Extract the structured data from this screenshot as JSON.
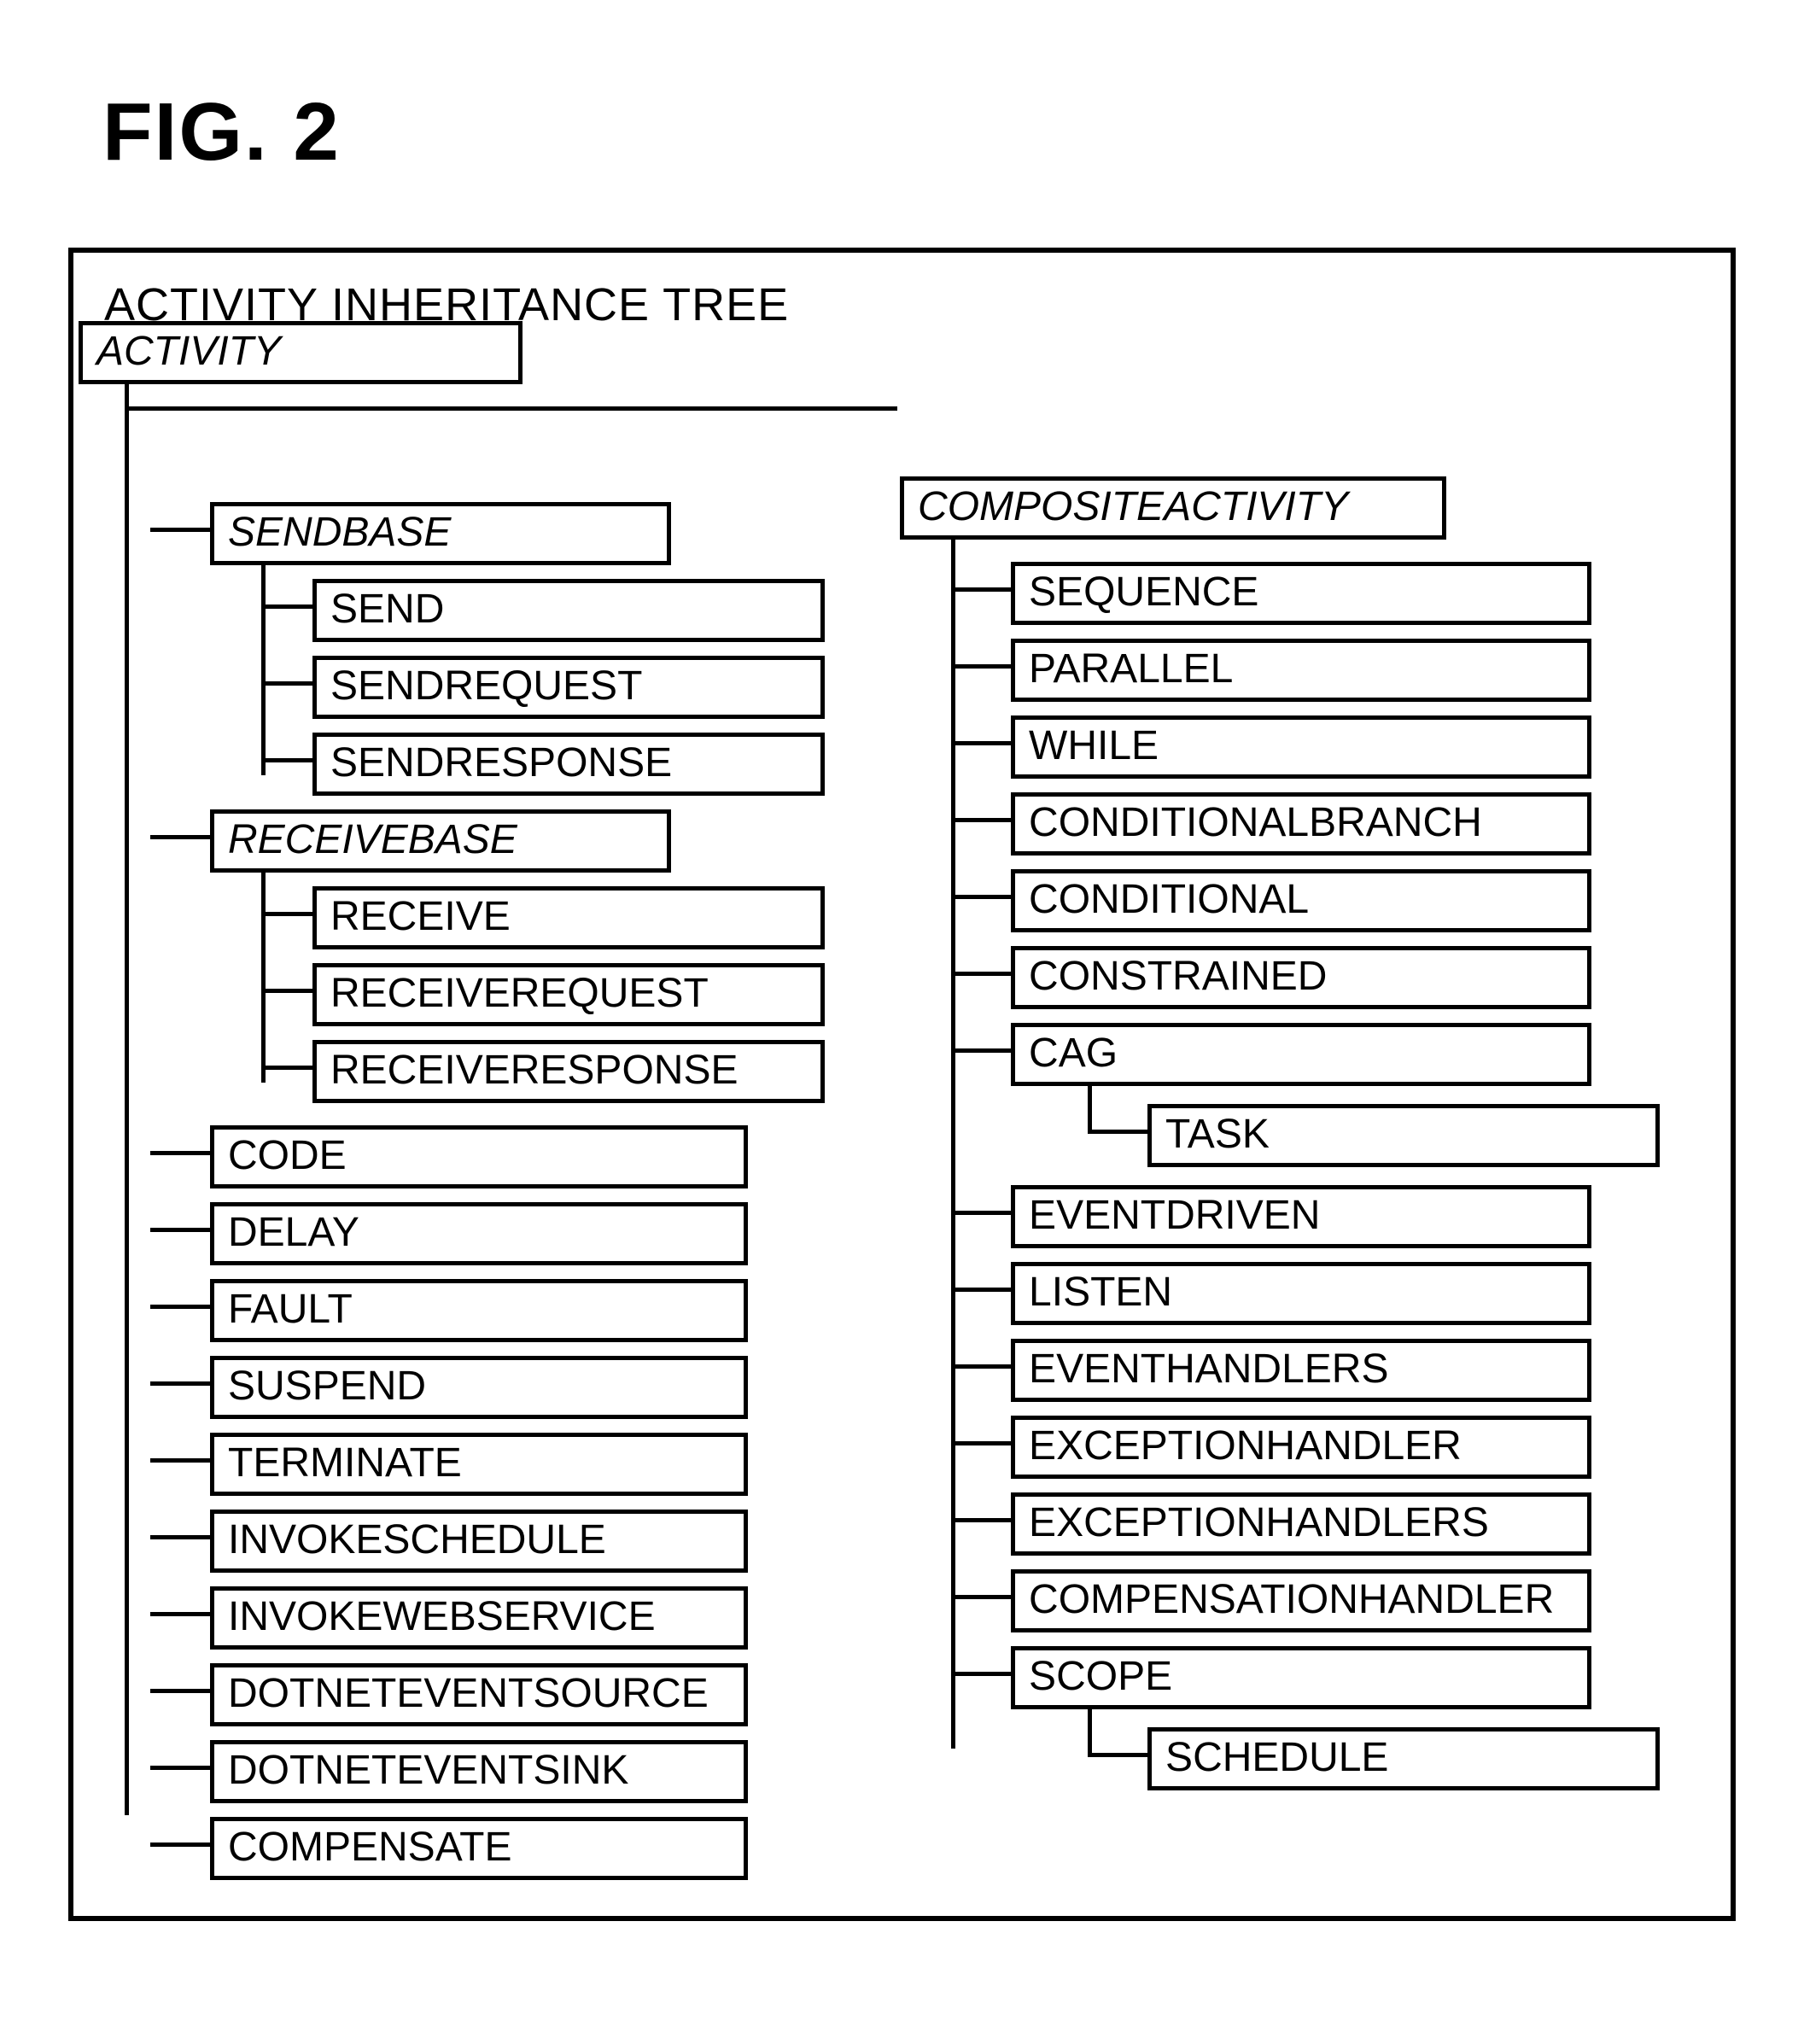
{
  "figure_label": "FIG. 2",
  "panel_title": "ACTIVITY INHERITANCE TREE",
  "root": "ACTIVITY",
  "left": {
    "sendbase": {
      "label": "SENDBASE",
      "children": [
        "SEND",
        "SENDREQUEST",
        "SENDRESPONSE"
      ]
    },
    "receivebase": {
      "label": "RECEIVEBASE",
      "children": [
        "RECEIVE",
        "RECEIVEREQUEST",
        "RECEIVERESPONSE"
      ]
    },
    "simple": [
      "CODE",
      "DELAY",
      "FAULT",
      "SUSPEND",
      "TERMINATE",
      "INVOKESCHEDULE",
      "INVOKEWEBSERVICE",
      "DOTNETEVENTSOURCE",
      "DOTNETEVENTSINK",
      "COMPENSATE"
    ]
  },
  "right": {
    "composite": {
      "label": "COMPOSITEACTIVITY",
      "children_first": [
        "SEQUENCE",
        "PARALLEL",
        "WHILE",
        "CONDITIONALBRANCH",
        "CONDITIONAL",
        "CONSTRAINED"
      ],
      "cag": {
        "label": "CAG",
        "child": "TASK"
      },
      "children_mid": [
        "EVENTDRIVEN",
        "LISTEN",
        "EVENTHANDLERS",
        "EXCEPTIONHANDLER",
        "EXCEPTIONHANDLERS",
        "COMPENSATIONHANDLER"
      ],
      "scope": {
        "label": "SCOPE",
        "child": "SCHEDULE"
      }
    }
  }
}
